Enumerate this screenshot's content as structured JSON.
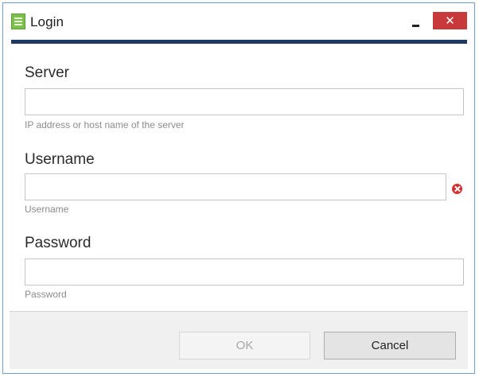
{
  "window": {
    "title": "Login",
    "minimize_icon": "minimize-icon",
    "close_icon": "close-icon",
    "close_glyph": "✕"
  },
  "form": {
    "server": {
      "label": "Server",
      "value": "",
      "hint": "IP address or host name of the server"
    },
    "username": {
      "label": "Username",
      "value": "",
      "hint": "Username",
      "error_icon": "error-icon"
    },
    "password": {
      "label": "Password",
      "value": "",
      "hint": "Password"
    }
  },
  "buttons": {
    "ok_label": "OK",
    "cancel_label": "Cancel"
  },
  "colors": {
    "title_accent": "#1f3864",
    "close_button": "#c7393a",
    "error": "#d32f2f",
    "app_icon": "#7cc04b",
    "window_border": "#6f9fd6"
  }
}
